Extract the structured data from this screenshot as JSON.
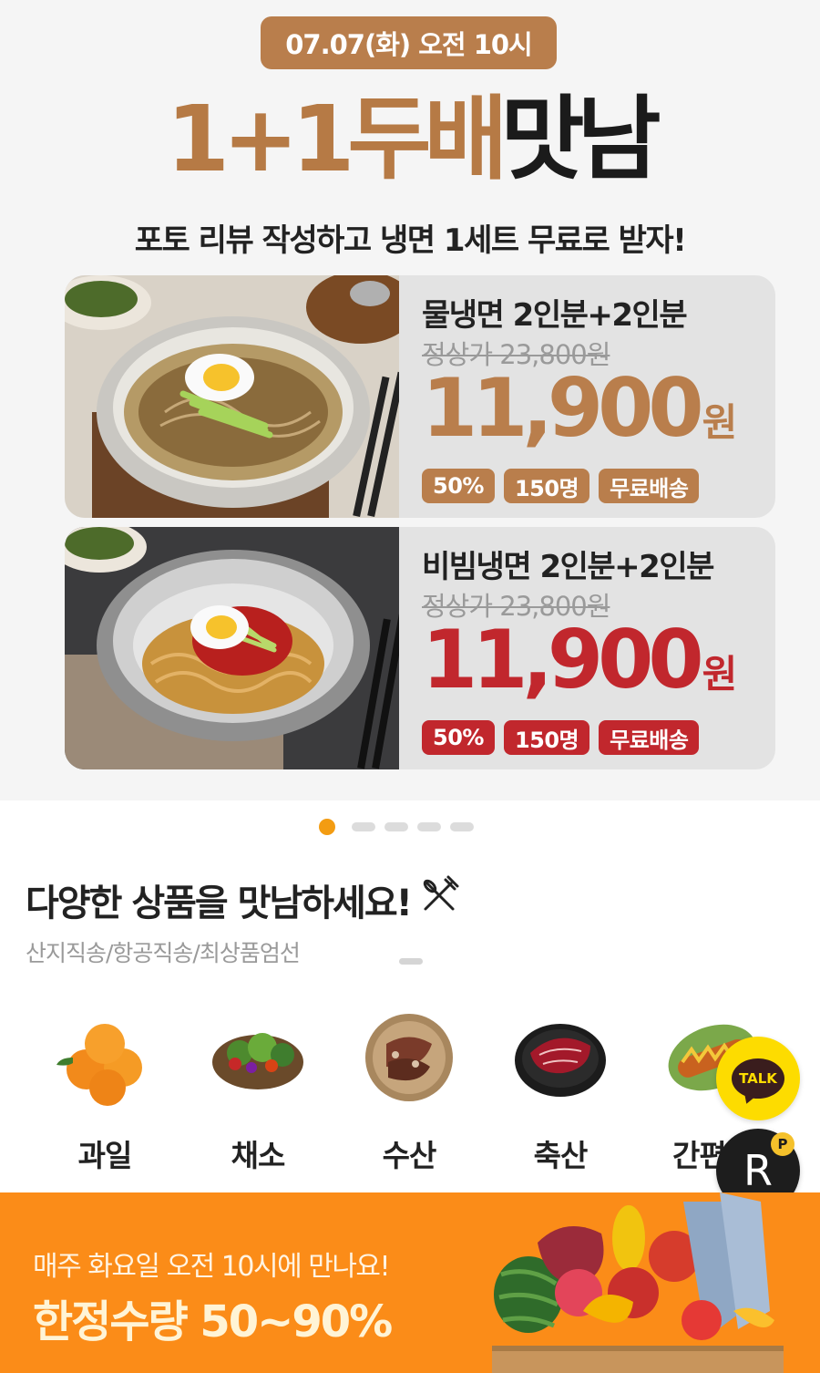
{
  "banner": {
    "date_label": "07.07(화) 오전 10시",
    "headline_brown": "1+1두배",
    "headline_black": "맛남",
    "subline": "포토 리뷰 작성하고 냉면 1세트 무료로 받자!",
    "products": [
      {
        "name": "물냉면 2인분+2인분",
        "original_price": "정상가    23,800원",
        "price": "11,900",
        "currency": "원",
        "badges": [
          "50%",
          "150명",
          "무료배송"
        ],
        "accent": "#b97e4c"
      },
      {
        "name": "비빔냉면 2인분+2인분",
        "original_price": "정상가    23,800원",
        "price": "11,900",
        "currency": "원",
        "badges": [
          "50%",
          "150명",
          "무료배송"
        ],
        "accent": "#c1272d"
      }
    ],
    "carousel": {
      "pages": 5,
      "active_page": 1
    }
  },
  "section": {
    "title": "다양한 상품을 맛남하세요!",
    "title_icon": "fork-knife-icon",
    "subtitle": "산지직송/항공직송/최상품엄선",
    "categories": [
      {
        "label": "과일",
        "icon": "tangerine-icon"
      },
      {
        "label": "채소",
        "icon": "vegetable-basket-icon"
      },
      {
        "label": "수산",
        "icon": "seafood-plate-icon"
      },
      {
        "label": "축산",
        "icon": "beef-plate-icon"
      },
      {
        "label": "간편식",
        "icon": "hotdog-plate-icon"
      }
    ]
  },
  "floating": {
    "talk_label": "TALK",
    "r_label": "R",
    "point_label": "P"
  },
  "promo": {
    "line1": "매주 화요일 오전 10시에 만나요!",
    "line2": "한정수량 50~90%"
  },
  "colors": {
    "brown": "#b97e4c",
    "red": "#c1272d",
    "orange": "#fb8c18",
    "kakao_yellow": "#fddc00"
  }
}
